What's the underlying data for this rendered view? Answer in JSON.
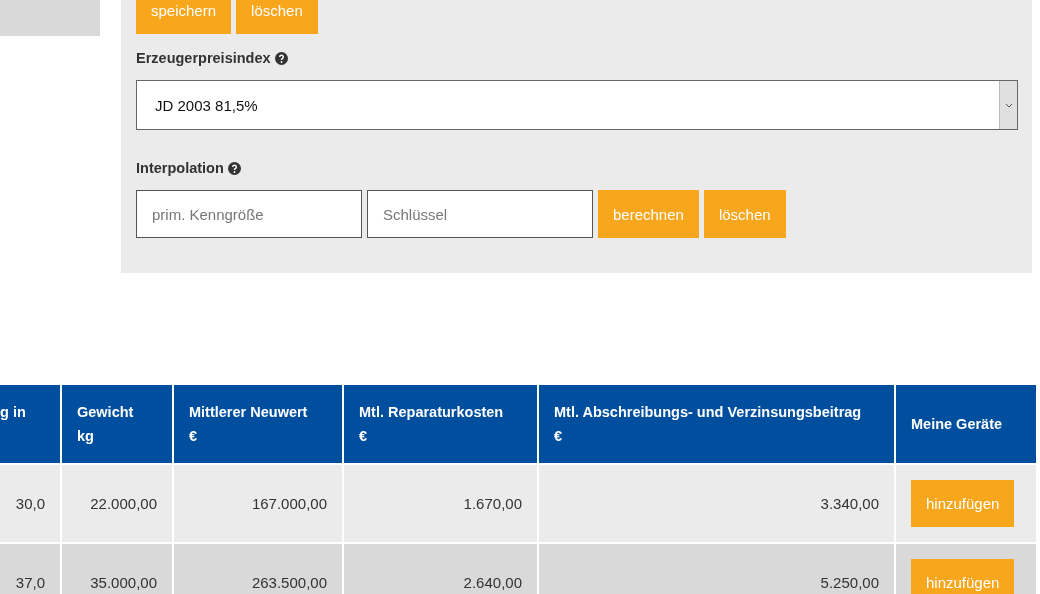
{
  "top_buttons": [
    "speichern",
    "löschen"
  ],
  "price_index": {
    "label": "Erzeugerpreisindex",
    "value": "JD 2003 81,5%"
  },
  "interpolation": {
    "label": "Interpolation",
    "fields": [
      {
        "placeholder": "prim. Kenngröße"
      },
      {
        "placeholder": "Schlüssel"
      }
    ],
    "buttons": [
      "berechnen",
      "löschen"
    ]
  },
  "table": {
    "columns": [
      {
        "label": "g in"
      },
      {
        "label": "Gewicht",
        "unit": "kg"
      },
      {
        "label": "Mittlerer Neuwert",
        "unit": "€"
      },
      {
        "label": "Mtl. Reparaturkosten",
        "unit": "€"
      },
      {
        "label": "Mtl. Abschreibungs- und Verzinsungsbeitrag",
        "unit": "€"
      },
      {
        "label": "Meine Geräte"
      }
    ],
    "rows": [
      {
        "cells": [
          "30,0",
          "22.000,00",
          "167.000,00",
          "1.670,00",
          "3.340,00"
        ],
        "action": "hinzufügen"
      },
      {
        "cells": [
          "37,0",
          "35.000,00",
          "263.500,00",
          "2.640,00",
          "5.250,00"
        ],
        "action": "hinzufügen"
      }
    ]
  }
}
